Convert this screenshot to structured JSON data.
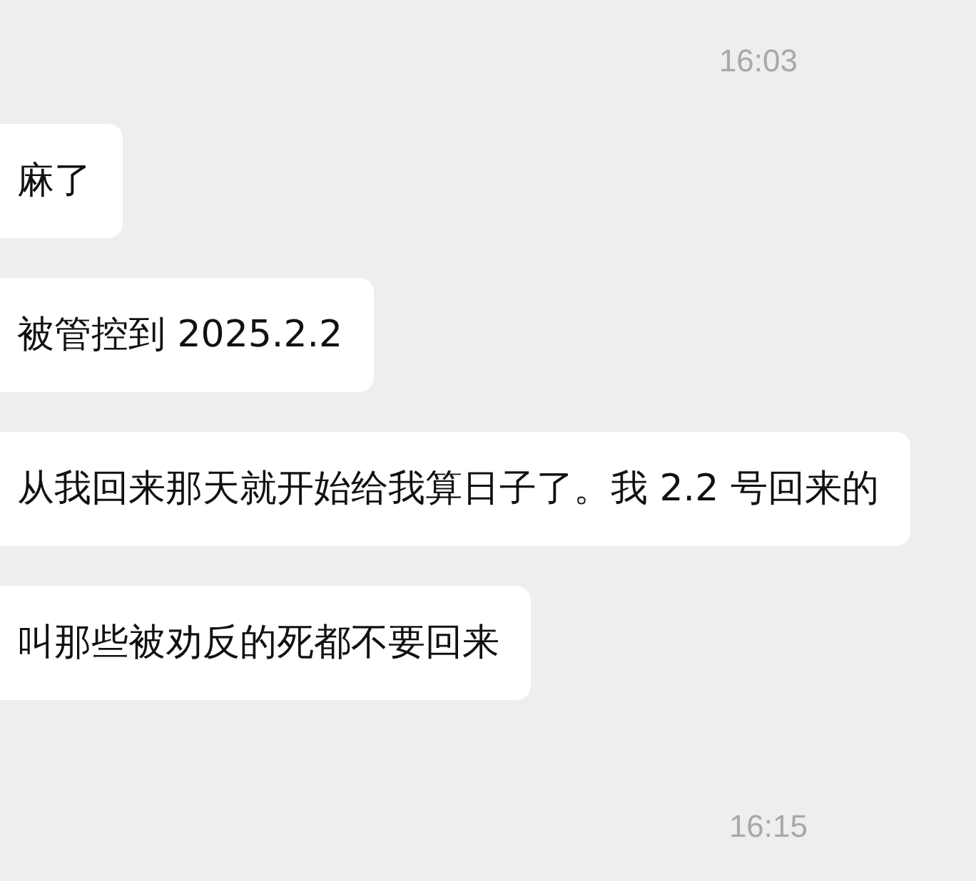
{
  "chat": [
    {
      "kind": "time",
      "text": "16:03"
    },
    {
      "kind": "message",
      "text": "麻了"
    },
    {
      "kind": "message",
      "text": "被管控到 2025.2.2"
    },
    {
      "kind": "message",
      "text": "从我回来那天就开始给我算日子了。我 2.2 号回来的"
    },
    {
      "kind": "message",
      "text": "叫那些被劝反的死都不要回来"
    },
    {
      "kind": "time",
      "text": "16:15"
    }
  ]
}
